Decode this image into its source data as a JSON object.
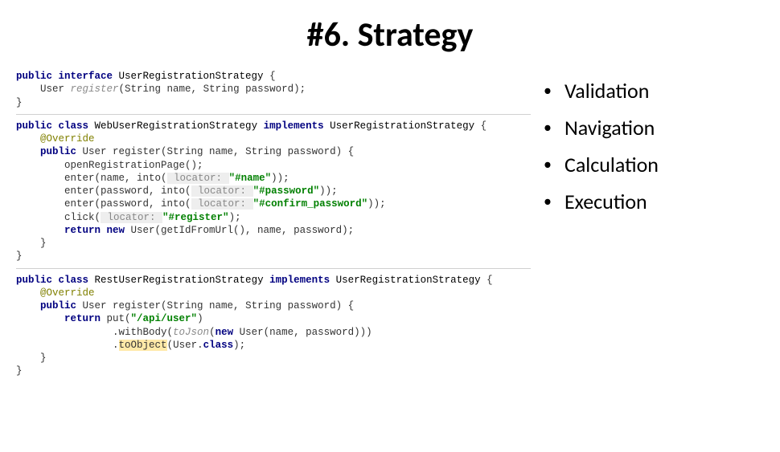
{
  "title": "#6. Strategy",
  "bullets": {
    "b0": "Validation",
    "b1": "Navigation",
    "b2": "Calculation",
    "b3": "Execution"
  },
  "code": {
    "iface": {
      "l0_kw1": "public interface ",
      "l0_name": "UserRegistrationStrategy ",
      "l0_brace": "{",
      "l1_indent": "    ",
      "l1_ret": "User ",
      "l1_method": "register",
      "l1_rest": "(String name, String password);",
      "l2": "}"
    },
    "web": {
      "l0_kw1": "public class ",
      "l0_name": "WebUserRegistrationStrategy ",
      "l0_kw2": "implements ",
      "l0_impl": "UserRegistrationStrategy ",
      "l0_brace": "{",
      "l1_indent": "    ",
      "l1_ann": "@Override",
      "l2_indent": "    ",
      "l2_kw": "public ",
      "l2_rest": "User register(String name, String password) {",
      "l3_indent": "        ",
      "l3_call": "openRegistrationPage();",
      "l4_indent": "        ",
      "l4_a": "enter(name, into(",
      "l4_hint": " locator: ",
      "l4_str": "\"#name\"",
      "l4_b": "));",
      "l5_indent": "        ",
      "l5_a": "enter(password, into(",
      "l5_hint": " locator: ",
      "l5_str": "\"#password\"",
      "l5_b": "));",
      "l6_indent": "        ",
      "l6_a": "enter(password, into(",
      "l6_hint": " locator: ",
      "l6_str": "\"#confirm_password\"",
      "l6_b": "));",
      "l7_indent": "        ",
      "l7_a": "click(",
      "l7_hint": " locator: ",
      "l7_str": "\"#register\"",
      "l7_b": ");",
      "l8_indent": "        ",
      "l8_kw": "return new ",
      "l8_rest": "User(getIdFromUrl(), name, password);",
      "l9_indent": "    ",
      "l9": "}",
      "l10": "}"
    },
    "rest": {
      "l0_kw1": "public class ",
      "l0_name": "RestUserRegistrationStrategy ",
      "l0_kw2": "implements ",
      "l0_impl": "UserRegistrationStrategy ",
      "l0_brace": "{",
      "l1_indent": "    ",
      "l1_ann": "@Override",
      "l2_indent": "    ",
      "l2_kw": "public ",
      "l2_rest": "User register(String name, String password) {",
      "l3_indent": "        ",
      "l3_kw": "return ",
      "l3_a": "put(",
      "l3_str": "\"/api/user\"",
      "l3_b": ")",
      "l4_indent": "                ",
      "l4_a": ".withBody(",
      "l4_i": "toJson",
      "l4_b": "(",
      "l4_kw": "new ",
      "l4_c": "User(name, password)))",
      "l5_indent": "                ",
      "l5_a": ".",
      "l5_hl": "toObject",
      "l5_b": "(User.",
      "l5_kw": "class",
      "l5_c": ");",
      "l6_indent": "    ",
      "l6": "}",
      "l7": "}"
    }
  }
}
